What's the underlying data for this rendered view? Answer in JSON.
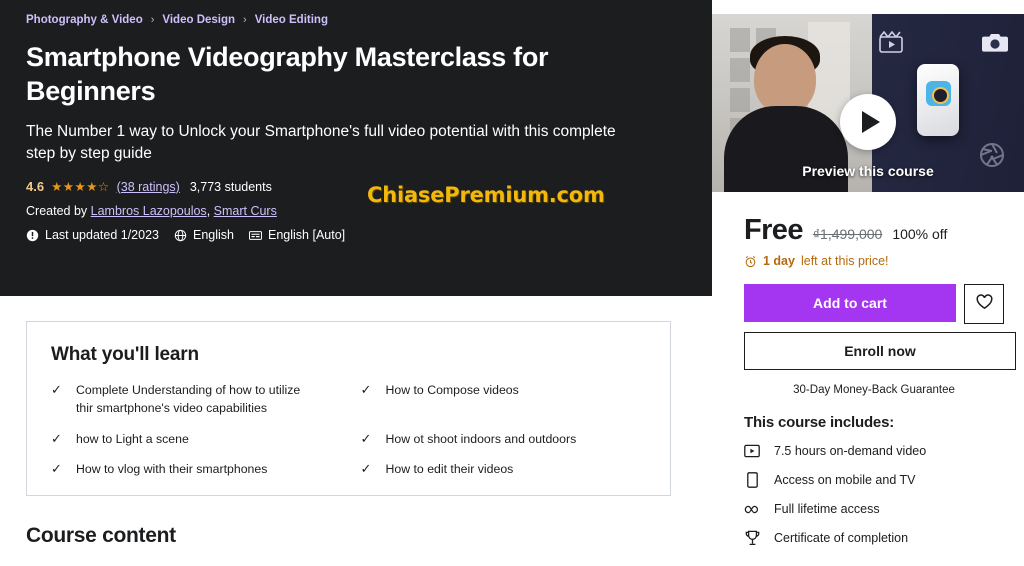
{
  "breadcrumb": {
    "items": [
      "Photography & Video",
      "Video Design",
      "Video Editing"
    ],
    "separator": "›"
  },
  "hero": {
    "title": "Smartphone Videography Masterclass for Beginners",
    "subtitle": "The Number 1 way to Unlock your Smartphone's full video potential with this complete step by step guide",
    "rating_value": "4.6",
    "stars_glyphs": "★★★★☆",
    "ratings_link": "(38 ratings)",
    "students": "3,773 students",
    "created_by_label": "Created by",
    "authors": [
      "Lambros Lazopoulos",
      "Smart Curs"
    ],
    "last_updated": "Last updated 1/2023",
    "language": "English",
    "captions": "English [Auto]",
    "watermark": "ChiasePremium.com"
  },
  "learn": {
    "heading": "What you'll learn",
    "items": [
      "Complete Understanding of how to utilize thir smartphone's video capabilities",
      "How to Compose videos",
      "how to Light a scene",
      "How ot shoot indoors and outdoors",
      "How to vlog with their smartphones",
      "How to edit their videos"
    ],
    "check_glyph": "✓"
  },
  "course_content": {
    "heading": "Course content"
  },
  "sidebar": {
    "preview_label": "Preview this course",
    "price_current": "Free",
    "price_original": "₫1,499,000",
    "discount": "100% off",
    "deal_strong": "1 day",
    "deal_rest": "left at this price!",
    "add_to_cart": "Add to cart",
    "enroll_now": "Enroll now",
    "guarantee": "30-Day Money-Back Guarantee",
    "includes_title": "This course includes:",
    "includes": [
      {
        "icon": "video-icon",
        "label": "7.5 hours on-demand video"
      },
      {
        "icon": "mobile-icon",
        "label": "Access on mobile and TV"
      },
      {
        "icon": "infinity-icon",
        "label": "Full lifetime access"
      },
      {
        "icon": "trophy-icon",
        "label": "Certificate of completion"
      }
    ]
  },
  "colors": {
    "hero_bg": "#1c1d1f",
    "accent_purple": "#a435f0",
    "link_purple": "#cec0fc",
    "star_orange": "#e59819",
    "deal_orange": "#b4690e",
    "watermark_yellow": "#f2b90c"
  }
}
